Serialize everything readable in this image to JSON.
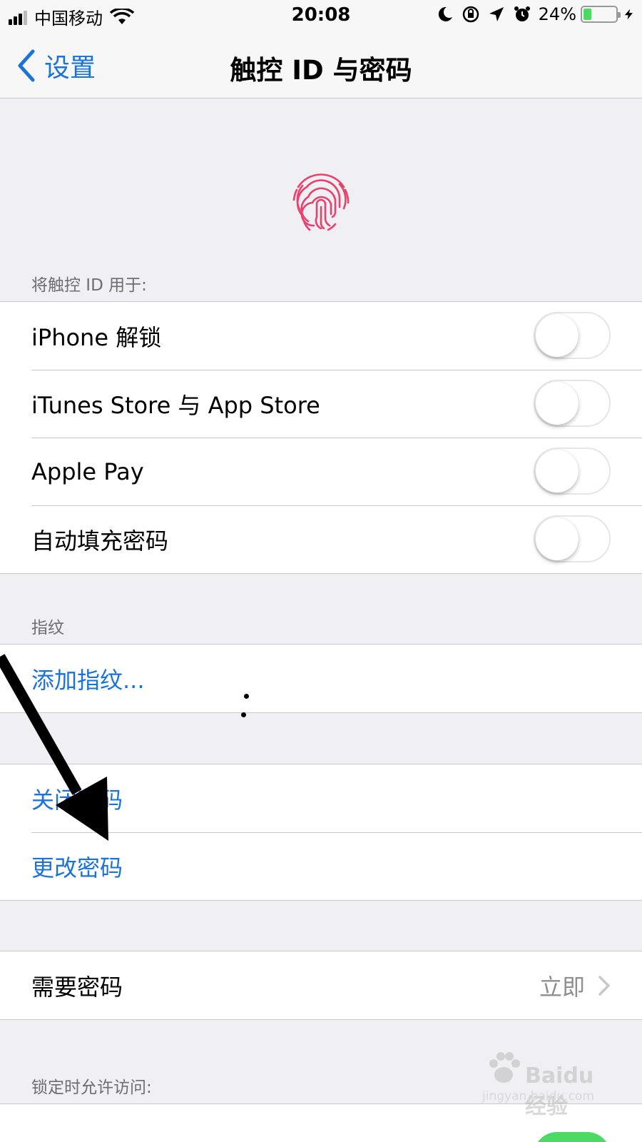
{
  "status_bar": {
    "carrier": "中国移动",
    "time": "20:08",
    "battery_percent": "24%",
    "battery_level": 0.24
  },
  "nav": {
    "back_label": "设置",
    "title": "触控 ID 与密码"
  },
  "touch_id_section": {
    "header": "将触控 ID 用于:",
    "items": [
      {
        "label": "iPhone 解锁",
        "enabled": false
      },
      {
        "label": "iTunes Store 与 App Store",
        "enabled": false
      },
      {
        "label": "Apple Pay",
        "enabled": false
      },
      {
        "label": "自动填充密码",
        "enabled": false
      }
    ]
  },
  "fingerprint_section": {
    "header": "指纹",
    "add_label": "添加指纹..."
  },
  "passcode_section": {
    "turn_off_label": "关闭密码",
    "change_label": "更改密码"
  },
  "require_passcode": {
    "label": "需要密码",
    "value": "立即"
  },
  "locked_access_section": {
    "header": "锁定时允许访问:"
  },
  "watermark": {
    "brand": "Baidu 经验",
    "url": "jingyan.baidu.com"
  },
  "colors": {
    "accent": "#1a73d9",
    "fingerprint": "#e8416b",
    "toggle_on": "#4cd964"
  }
}
